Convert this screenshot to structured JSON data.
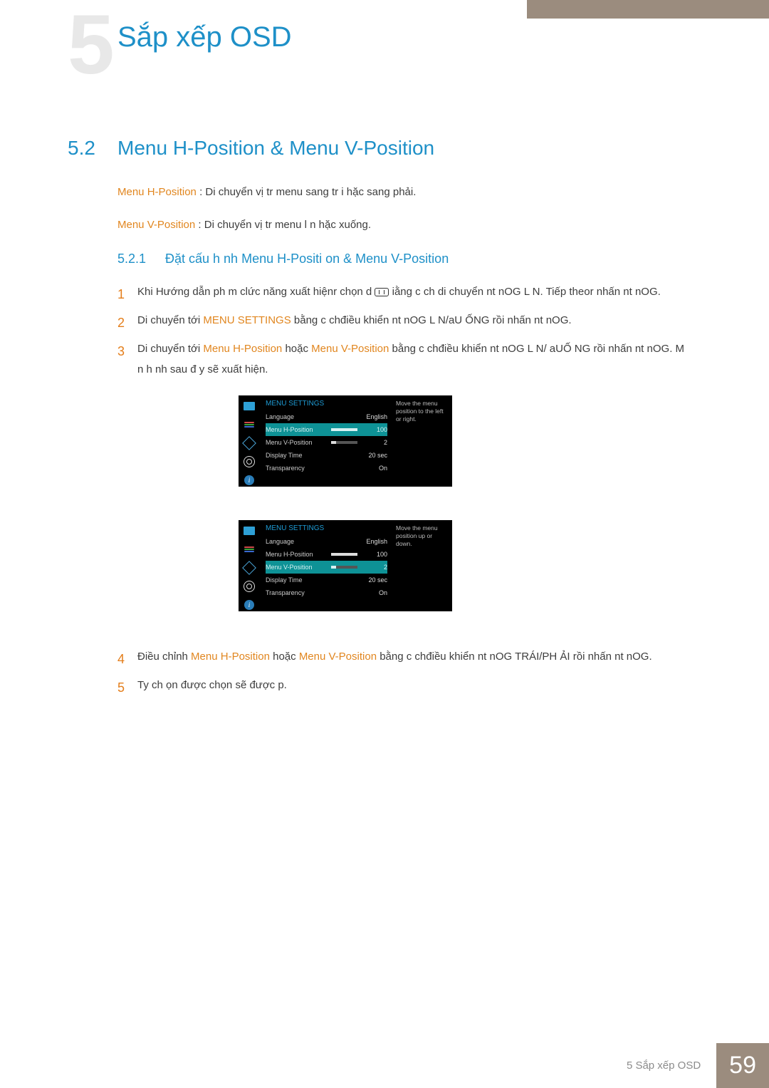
{
  "chapter": {
    "bg_number": "5",
    "title": "Sắp xếp OSD"
  },
  "section": {
    "num": "5.2",
    "title": "Menu H-Position & Menu V-Position"
  },
  "intro": {
    "h": {
      "label": "Menu H-Position",
      "text": ": Di chuyển vị tr  menu sang tr i hặc sang phải."
    },
    "v": {
      "label": "Menu V-Position",
      "text": ": Di chuyển vị tr  menu l n hặc xuống."
    }
  },
  "sub": {
    "num": "5.2.1",
    "title": "Đặt cấu h nh Menu H-Positi on & Menu V-Position"
  },
  "steps": {
    "s1": {
      "n": "1",
      "a": "Khi Hướng dẫn ph m clức năng xuất hiệnr chọn d ",
      "b": " iằng c ch di chuyển nt nOG L N. Tiếp theor nhấn nt nOG."
    },
    "s2": {
      "n": "2",
      "a": "Di chuyển tới ",
      "menu": "MENU SETTINGS",
      "b": " bằng c chđiều khiển nt nOG L N/aU  ỐNG rồi nhấn nt nOG."
    },
    "s3": {
      "n": "3",
      "a": "Di chuyển tới ",
      "h": "Menu H-Position",
      "mid": "  hoặc ",
      "v": "Menu V-Position",
      "b": "  bằng c chđiều khiển nt nOG L N/ aUỐ NG rồi nhấn nt nOG. M n h nh sau đ y sẽ xuất hiện."
    },
    "s4": {
      "n": "4",
      "a": "Điều chỉnh ",
      "h": "Menu H-Position",
      "mid": "  hoặc ",
      "v": "Menu V-Position",
      "b": "  bằng c chđiều khiển nt nOG TRÁI/PH  ẢI rồi nhấn nt nOG."
    },
    "s5": {
      "n": "5",
      "a": "Ty ch  ọn được chọn sẽ được  p."
    }
  },
  "osd": {
    "header": "MENU SETTINGS",
    "hint_h": "Move the menu position to the left or right.",
    "hint_v": "Move the menu position up or down.",
    "rows": {
      "lang": {
        "label": "Language",
        "value": "English"
      },
      "hpos": {
        "label": "Menu H-Position",
        "value": "100",
        "fill": "100%"
      },
      "vpos": {
        "label": "Menu V-Position",
        "value": "2",
        "fill": "20%"
      },
      "time": {
        "label": "Display Time",
        "value": "20 sec"
      },
      "trans": {
        "label": "Transparency",
        "value": "On"
      }
    },
    "info_glyph": "i"
  },
  "footer": {
    "text": "5 Sắp xếp OSD",
    "page": "59"
  }
}
